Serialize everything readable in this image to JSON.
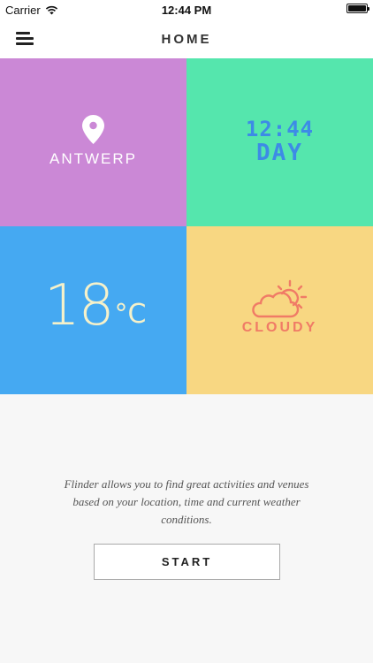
{
  "status_bar": {
    "carrier": "Carrier",
    "time": "12:44 PM"
  },
  "navbar": {
    "title": "HOME"
  },
  "tiles": {
    "location": {
      "label": "ANTWERP",
      "icon": "location-pin-icon",
      "color": "#cb88d6"
    },
    "time": {
      "clock": "12:44",
      "period": "DAY",
      "color": "#55e6ad"
    },
    "temperature": {
      "value": "18",
      "unit": "°C",
      "color": "#45a9f2"
    },
    "weather": {
      "label": "CLOUDY",
      "icon": "cloudy-sun-icon",
      "color": "#f8d782"
    }
  },
  "description": "Flinder allows you to find great activities and venues based on your location, time and current weather conditions.",
  "start_button": {
    "label": "START"
  }
}
